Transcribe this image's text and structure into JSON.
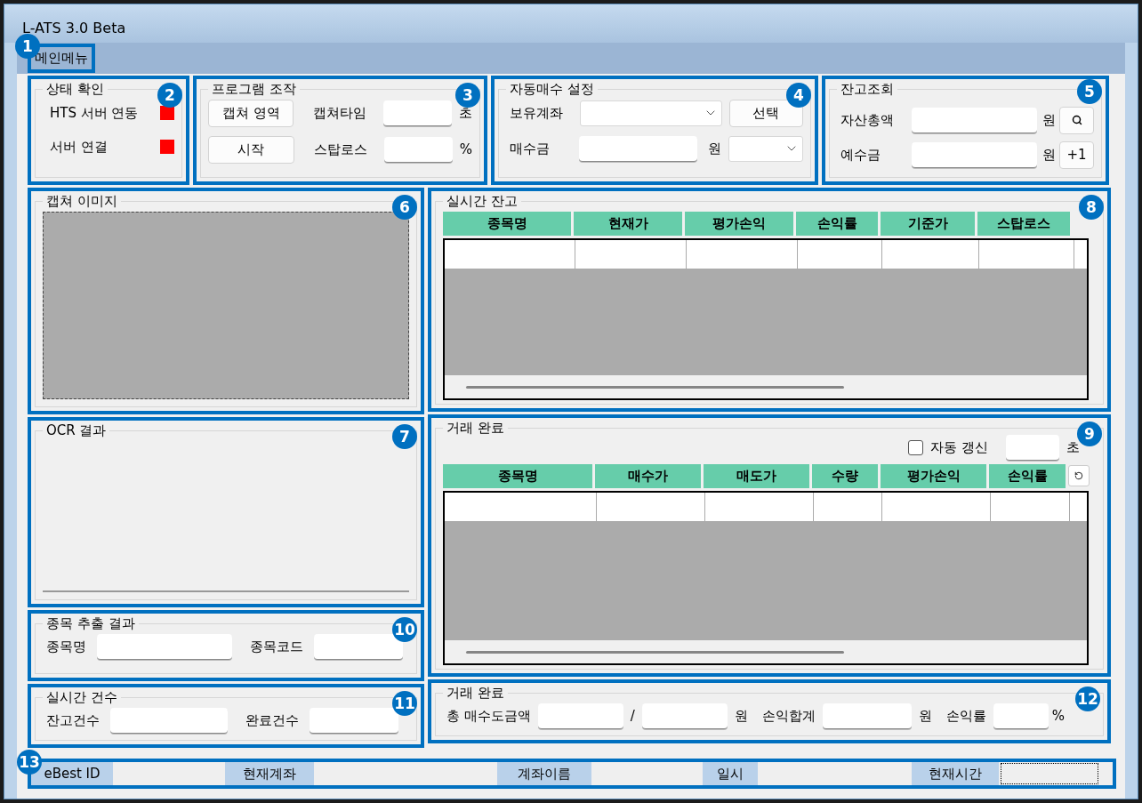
{
  "window": {
    "title": "L-ATS 3.0 Beta"
  },
  "menu": {
    "callout": "1",
    "items": [
      {
        "label": "메인메뉴"
      }
    ]
  },
  "status_check": {
    "title": "상태 확인",
    "callout": "2",
    "indicators": [
      {
        "label": "HTS 서버 연동",
        "color": "#ff0000"
      },
      {
        "label": "서버 연결",
        "color": "#ff0000"
      }
    ]
  },
  "program_control": {
    "title": "프로그램 조작",
    "callout": "3",
    "buttons": [
      "캡쳐 영역",
      "시작"
    ],
    "fields": [
      {
        "label": "캡쳐타임",
        "unit": "초"
      },
      {
        "label": "스탑로스",
        "unit": "%"
      }
    ]
  },
  "auto_buy": {
    "title": "자동매수 설정",
    "callout": "4",
    "account_label": "보유계좌",
    "select_button": "선택",
    "amount_label": "매수금",
    "amount_unit": "원"
  },
  "balance_query": {
    "title": "잔고조회",
    "callout": "5",
    "rows": [
      {
        "label": "자산총액",
        "unit": "원",
        "button": {
          "kind": "search"
        }
      },
      {
        "label": "예수금",
        "unit": "원",
        "button": {
          "kind": "text",
          "text": "+1"
        }
      }
    ]
  },
  "capture_image": {
    "title": "캡쳐 이미지",
    "callout": "6"
  },
  "realtime_balance": {
    "title": "실시간 잔고",
    "callout": "8",
    "columns": [
      "종목명",
      "현재가",
      "평가손익",
      "손익률",
      "기준가",
      "스탑로스"
    ]
  },
  "ocr_result": {
    "title": "OCR 결과",
    "callout": "7"
  },
  "trades_done": {
    "title": "거래 완료",
    "callout": "9",
    "auto_refresh": {
      "label": "자동 갱신",
      "checked": false,
      "unit": "초"
    },
    "columns": [
      "종목명",
      "매수가",
      "매도가",
      "수량",
      "평가손익",
      "손익률"
    ]
  },
  "stock_extract": {
    "title": "종목 추출 결과",
    "callout": "10",
    "fields": [
      {
        "label": "종목명"
      },
      {
        "label": "종목코드"
      }
    ]
  },
  "realtime_counts": {
    "title": "실시간 건수",
    "callout": "11",
    "fields": [
      {
        "label": "잔고건수"
      },
      {
        "label": "완료건수"
      }
    ]
  },
  "trade_summary": {
    "title": "거래 완료",
    "callout": "12",
    "total_label": "총 매수도금액",
    "separator": "/",
    "total_unit": "원",
    "pl_label": "손익합계",
    "pl_unit": "원",
    "rate_label": "손익률",
    "rate_unit": "%"
  },
  "status_bar": {
    "callout": "13",
    "fields": [
      {
        "label": "eBest ID"
      },
      {
        "label": "현재계좌"
      },
      {
        "label": "계좌이름"
      },
      {
        "label": "일시"
      },
      {
        "label": "현재시간"
      }
    ]
  }
}
